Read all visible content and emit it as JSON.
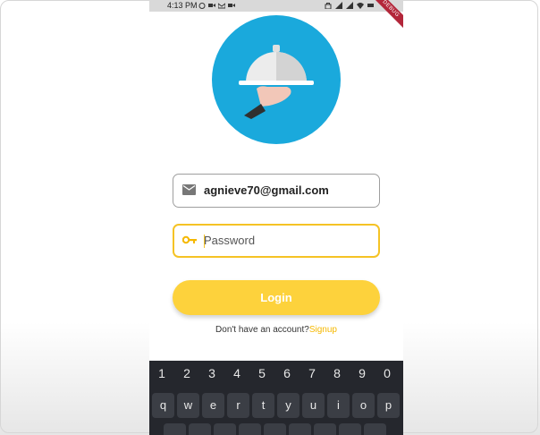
{
  "status_bar": {
    "time": "4:13 PM",
    "debug_label": "DEBUG"
  },
  "login_form": {
    "email_value": "agnieve70@gmail.com",
    "password_placeholder": "Password",
    "login_label": "Login",
    "signup_prompt": "Don't have an account?",
    "signup_link": "Signup"
  },
  "keyboard": {
    "number_row": [
      "1",
      "2",
      "3",
      "4",
      "5",
      "6",
      "7",
      "8",
      "9",
      "0"
    ],
    "letter_row": [
      "q",
      "w",
      "e",
      "r",
      "t",
      "y",
      "u",
      "i",
      "o",
      "p"
    ]
  },
  "colors": {
    "accent_yellow": "#fdd23c",
    "logo_blue": "#1aa9dc"
  }
}
